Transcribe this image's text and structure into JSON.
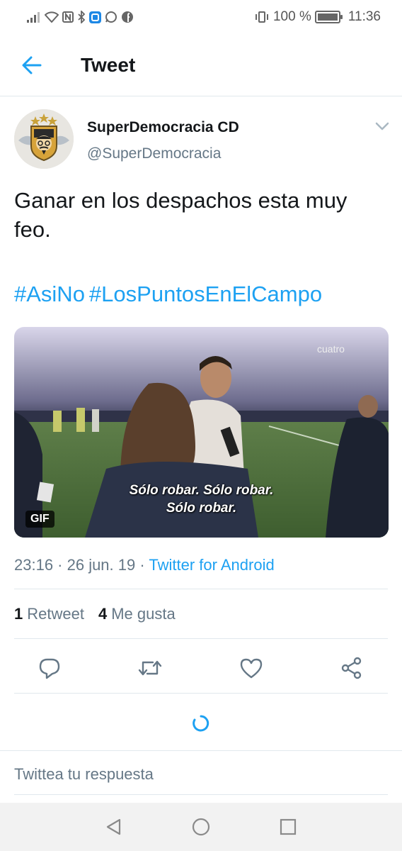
{
  "status_bar": {
    "icons": [
      "signal-icon",
      "wifi-icon",
      "nfc-icon",
      "bluetooth-icon",
      "app-icon",
      "whatsapp-icon",
      "facebook-icon"
    ],
    "battery_text": "100 %",
    "battery_level": 1.0,
    "time": "11:36"
  },
  "header": {
    "back_icon": "arrow-left-icon",
    "title": "Tweet"
  },
  "tweet": {
    "author_name": "SuperDemocracia CD",
    "author_handle": "@SuperDemocracia",
    "text": "Ganar en los despachos esta muy feo.",
    "hashtags": [
      "#AsiNo",
      "#LosPuntosEnElCampo"
    ],
    "media": {
      "badge": "GIF",
      "subtitle_line1": "Sólo robar. Sólo robar.",
      "subtitle_line2": "Sólo robar.",
      "watermark": "cuatro"
    },
    "timestamp": "23:16 · 26 jun. 19 · ",
    "source": "Twitter for Android",
    "retweets_count": "1",
    "retweets_label": "Retweet",
    "likes_count": "4",
    "likes_label": "Me gusta"
  },
  "actions": [
    "reply-icon",
    "retweet-icon",
    "like-icon",
    "share-icon"
  ],
  "colors": {
    "accent": "#1da1f2",
    "muted": "#657786",
    "text": "#14171a",
    "divider": "#e1e8ed"
  },
  "reply": {
    "placeholder": "Twittea tu respuesta"
  },
  "nav": [
    "back-triangle-icon",
    "home-circle-icon",
    "recents-square-icon"
  ]
}
